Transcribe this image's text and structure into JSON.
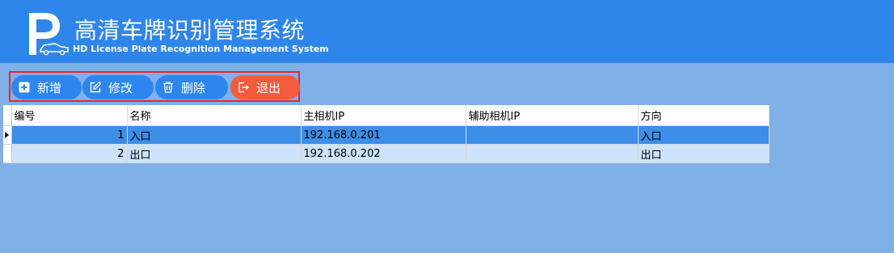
{
  "header": {
    "title_cn": "高清车牌识别管理系统",
    "title_en": "HD License Plate Recognition Management System",
    "brand_color": "#2f86ea"
  },
  "toolbar": {
    "add_label": "新增",
    "edit_label": "修改",
    "delete_label": "删除",
    "exit_label": "退出",
    "exit_color": "#f45b3c",
    "button_color": "#2d86ee"
  },
  "grid": {
    "columns": [
      "编号",
      "名称",
      "主相机IP",
      "辅助相机IP",
      "方向"
    ],
    "rows": [
      {
        "id": "1",
        "name": "入口",
        "main_ip": "192.168.0.201",
        "aux_ip": "",
        "direction": "入口"
      },
      {
        "id": "2",
        "name": "出口",
        "main_ip": "192.168.0.202",
        "aux_ip": "",
        "direction": "出口"
      }
    ],
    "selected_row": 0
  }
}
